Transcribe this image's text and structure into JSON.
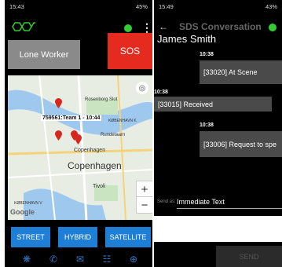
{
  "phone1": {
    "status": {
      "time": "15:43",
      "right": "45%"
    },
    "buttons": {
      "lone_worker": "Lone Worker",
      "sos": "SOS"
    },
    "map": {
      "callout": "759561:Team 1 - 10:44",
      "labels": {
        "rosenborg": "Rosenborg Slot",
        "kobenhavn_k": "KØBENHAVN K",
        "rundetaarn": "Rundetaarn",
        "copenhagen_small": "Copenhagen",
        "copenhagen_big": "Copenhagen",
        "tivoli": "Tivoli",
        "kobenhavn_v": "KØBENHAVN V",
        "google": "Google"
      },
      "zoom_in": "+",
      "zoom_out": "−",
      "type_buttons": [
        "STREET",
        "HYBRID",
        "SATELLITE"
      ]
    },
    "colors": {
      "accent": "#1f7fd6",
      "sos": "#e52b1f",
      "online": "#33cc33"
    }
  },
  "phone2": {
    "status": {
      "time": "15:49",
      "right": "43%"
    },
    "title": "SDS Conversation",
    "contact": "James Smith",
    "messages": [
      {
        "time": "10:38",
        "text": "[33020] At Scene",
        "side": "right"
      },
      {
        "time": "10:38",
        "text": "[33015] Received",
        "side": "left"
      },
      {
        "time": "10:38",
        "text": "[33006] Request to spe",
        "side": "right"
      }
    ],
    "send_as_label": "Send as:",
    "send_as_value": "Immediate Text",
    "send_button": "SEND"
  }
}
